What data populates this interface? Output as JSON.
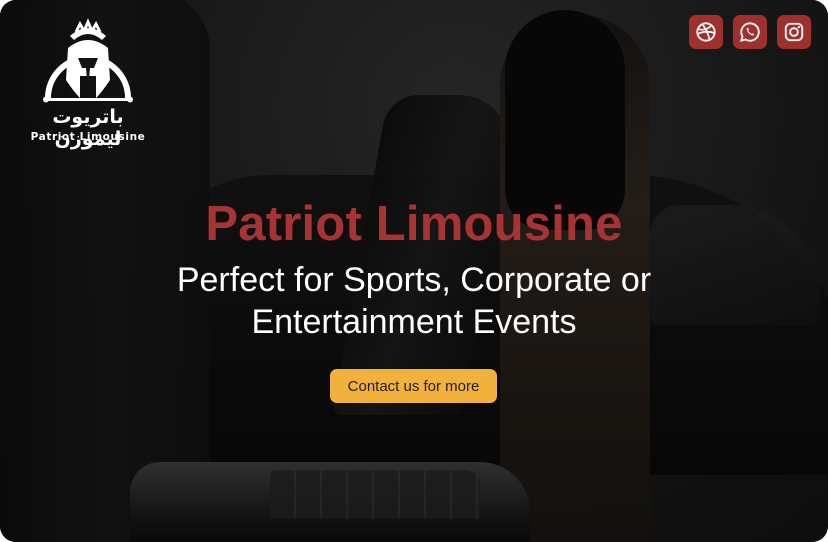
{
  "brand": {
    "logo_arabic": "باتريوت ليموزن",
    "logo_english": "Patriot Limousine"
  },
  "socials": [
    {
      "name": "dribbble",
      "icon": "dribbble-icon"
    },
    {
      "name": "whatsapp",
      "icon": "whatsapp-icon"
    },
    {
      "name": "instagram",
      "icon": "instagram-icon"
    }
  ],
  "hero": {
    "title": "Patriot Limousine",
    "subtitle_line1": "Perfect for Sports, Corporate or",
    "subtitle_line2": "Entertainment Events",
    "cta_label": "Contact us for more"
  },
  "colors": {
    "accent_red": "#a73432",
    "social_bg": "#a0302e",
    "cta_bg": "#f2b13d",
    "background": "#141414"
  }
}
